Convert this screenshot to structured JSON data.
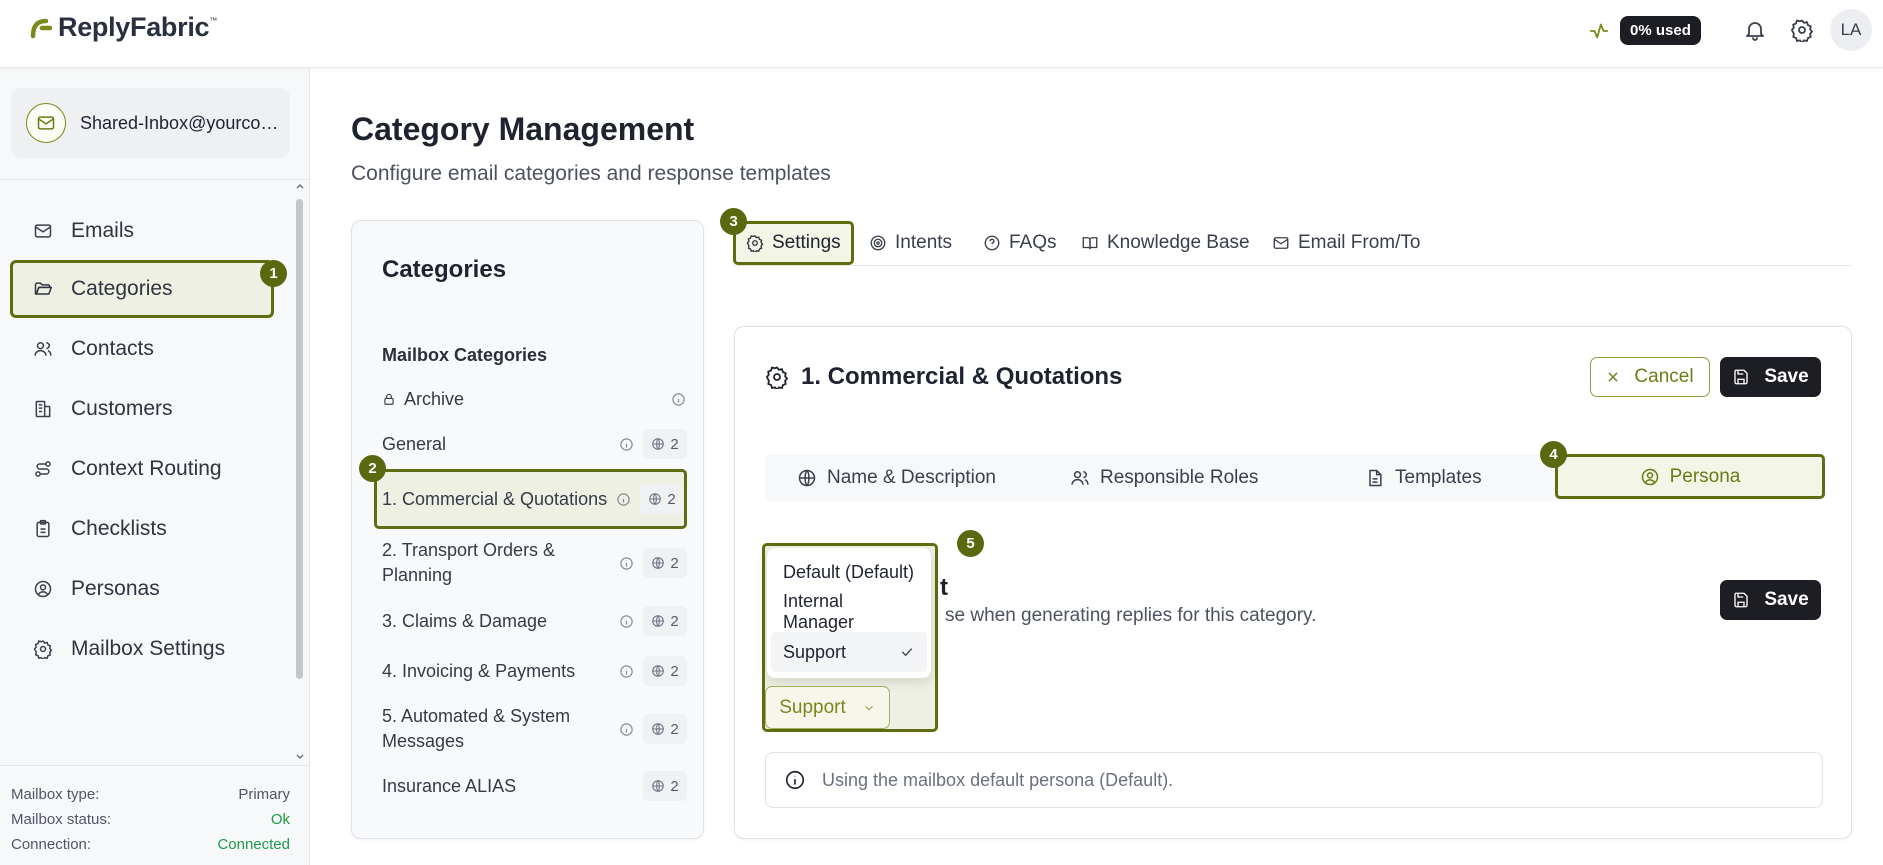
{
  "app": {
    "name": "ReplyFabric",
    "trademark": "™"
  },
  "topbar": {
    "usage_label": "0% used",
    "avatar_initials": "LA",
    "icons": [
      "activity-icon",
      "bell-icon",
      "gear-icon"
    ]
  },
  "sidebar": {
    "mailbox": "Shared-Inbox@yourcompany.com",
    "items": [
      {
        "label": "Emails",
        "icon": "mail-icon"
      },
      {
        "label": "Categories",
        "icon": "folder-open-icon",
        "active": true
      },
      {
        "label": "Contacts",
        "icon": "users-icon"
      },
      {
        "label": "Customers",
        "icon": "building-icon"
      },
      {
        "label": "Context Routing",
        "icon": "route-icon"
      },
      {
        "label": "Checklists",
        "icon": "clipboard-icon"
      },
      {
        "label": "Personas",
        "icon": "user-circle-icon"
      },
      {
        "label": "Mailbox Settings",
        "icon": "gear-icon"
      }
    ],
    "meta": [
      {
        "label": "Mailbox type:",
        "value": "Primary"
      },
      {
        "label": "Mailbox status:",
        "value": "Ok"
      },
      {
        "label": "Connection:",
        "value": "Connected"
      }
    ]
  },
  "badges": [
    "1",
    "2",
    "3",
    "4",
    "5"
  ],
  "page": {
    "title": "Category Management",
    "subtitle": "Configure email categories and response templates"
  },
  "categories": {
    "title": "Categories",
    "section": "Mailbox Categories",
    "items": [
      {
        "label": "Archive",
        "locked": true,
        "count": ""
      },
      {
        "label": "General",
        "count": "2"
      },
      {
        "label": "1. Commercial & Quotations",
        "count": "2",
        "active": true
      },
      {
        "label": "2. Transport Orders & Planning",
        "count": "2"
      },
      {
        "label": "3. Claims & Damage",
        "count": "2"
      },
      {
        "label": "4. Invoicing & Payments",
        "count": "2"
      },
      {
        "label": "5. Automated & System Messages",
        "count": "2"
      },
      {
        "label": "Insurance ALIAS",
        "count": "2"
      }
    ]
  },
  "tabs": [
    {
      "label": "Settings",
      "icon": "gear-icon",
      "active": true
    },
    {
      "label": "Intents",
      "icon": "target-icon"
    },
    {
      "label": "FAQs",
      "icon": "help-circle-icon"
    },
    {
      "label": "Knowledge Base",
      "icon": "book-icon"
    },
    {
      "label": "Email From/To",
      "icon": "mail-icon"
    }
  ],
  "editor": {
    "title": "1. Commercial & Quotations",
    "cancel_label": "Cancel",
    "save_label": "Save",
    "subtabs": [
      {
        "label": "Name & Description",
        "icon": "globe-icon"
      },
      {
        "label": "Responsible Roles",
        "icon": "users-icon"
      },
      {
        "label": "Templates",
        "icon": "file-text-icon"
      },
      {
        "label": "Persona",
        "icon": "user-circle-icon",
        "active": true
      }
    ],
    "persona": {
      "heading_visible": "t",
      "description_visible": "se when generating replies for this category.",
      "save_label": "Save",
      "options": [
        "Default (Default)",
        "Internal Manager",
        "Support"
      ],
      "selected": "Support",
      "info": "Using the mailbox default persona (Default)."
    }
  },
  "colors": {
    "accent": "#5f6d10",
    "accent_light": "#eef0e3",
    "dark": "#1c1e23",
    "ok": "#1d9a45"
  }
}
